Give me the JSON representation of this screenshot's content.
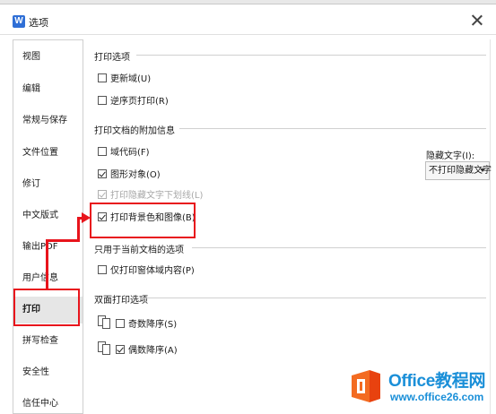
{
  "window": {
    "title": "选项",
    "app_icon": "W"
  },
  "sidebar": {
    "items": [
      {
        "label": "视图"
      },
      {
        "label": "编辑"
      },
      {
        "label": "常规与保存"
      },
      {
        "label": "文件位置"
      },
      {
        "label": "修订"
      },
      {
        "label": "中文版式"
      },
      {
        "label": "输出PDF"
      },
      {
        "label": "用户信息"
      },
      {
        "label": "打印",
        "active": true
      },
      {
        "label": "拼写检查"
      },
      {
        "label": "安全性"
      },
      {
        "label": "信任中心"
      }
    ]
  },
  "print_options": {
    "title": "打印选项",
    "update_fields": "更新域(U)",
    "reverse_order": "逆序页打印(R)"
  },
  "extra_info": {
    "title": "打印文档的附加信息",
    "field_codes": "域代码(F)",
    "graphic_objects": "图形对象(O)",
    "hidden_underline": "打印隐藏文字下划线(L)",
    "background": "打印背景色和图像(B)",
    "hidden_text_label": "隐藏文字(I):",
    "hidden_text_value": "不打印隐藏文字"
  },
  "current_doc": {
    "title": "只用于当前文档的选项",
    "form_only": "仅打印窗体域内容(P)"
  },
  "duplex": {
    "title": "双面打印选项",
    "odd_reverse": "奇数降序(S)",
    "even_reverse": "偶数降序(A)"
  },
  "checkbox_state": {
    "update_fields": false,
    "reverse_order": false,
    "field_codes": false,
    "graphic_objects": true,
    "hidden_underline": true,
    "background": true,
    "form_only": false,
    "odd_reverse": false,
    "even_reverse": true
  },
  "highlight_color": "#e8141c",
  "watermark": {
    "title": "Office教程网",
    "url": "www.office26.com"
  }
}
